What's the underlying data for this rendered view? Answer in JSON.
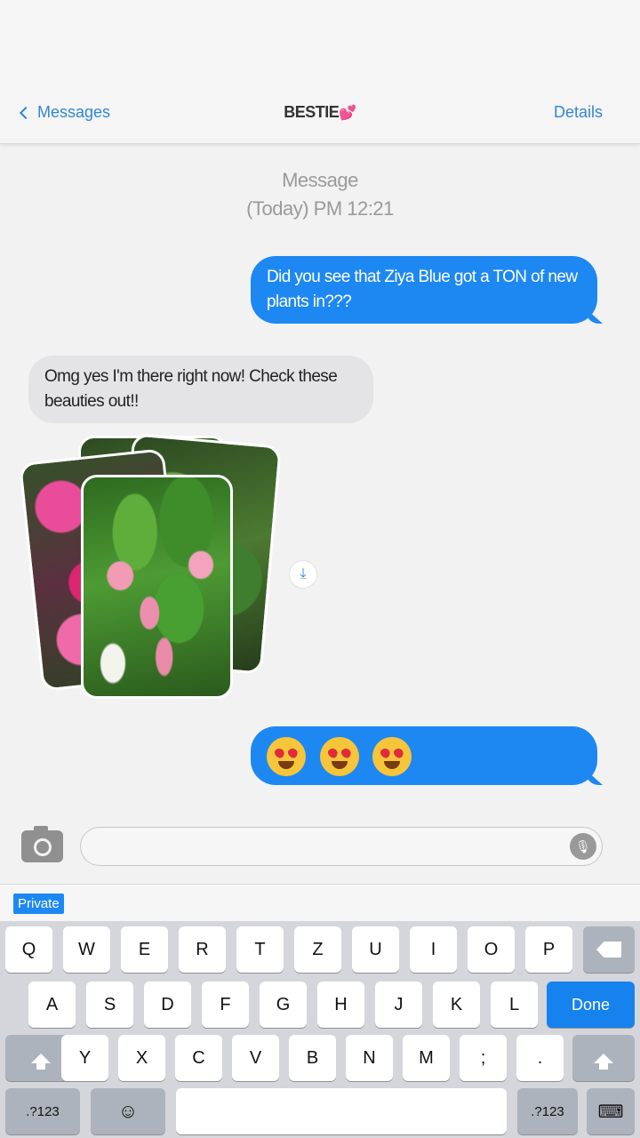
{
  "header": {
    "back_label": "Messages",
    "title": "BESTIE",
    "title_emoji": "💕",
    "details_label": "Details"
  },
  "timestamp": {
    "line1": "Message",
    "line2": "(Today) PM 12:21"
  },
  "messages": [
    {
      "direction": "outgoing",
      "text": "Did you see that Ziya Blue got a TON of new plants in???"
    },
    {
      "direction": "incoming",
      "text": "Omg yes I'm there right now! Check these beauties out!!"
    },
    {
      "direction": "incoming",
      "type": "photo-stack",
      "count": 3
    },
    {
      "direction": "outgoing",
      "type": "emoji",
      "emojis": [
        "heart-eyes",
        "heart-eyes",
        "heart-eyes"
      ]
    }
  ],
  "composer": {
    "placeholder": ""
  },
  "keyboard": {
    "private_label": "Private",
    "row1": [
      "Q",
      "W",
      "E",
      "R",
      "T",
      "Z",
      "U",
      "I",
      "O",
      "P"
    ],
    "row2": [
      "A",
      "S",
      "D",
      "F",
      "G",
      "H",
      "J",
      "K",
      "L"
    ],
    "done_label": "Done",
    "row3": [
      "Y",
      "X",
      "C",
      "V",
      "B",
      "N",
      "M",
      ";",
      "."
    ],
    "numbers_label": ".?123"
  },
  "colors": {
    "accent": "#1e88f2",
    "link": "#2f87d6",
    "incoming_bubble": "#e4e4e6"
  }
}
